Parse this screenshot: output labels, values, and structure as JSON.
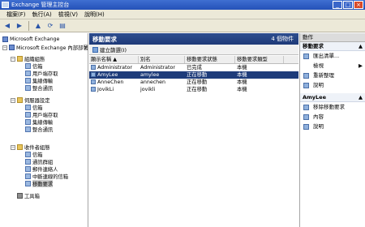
{
  "window": {
    "title": "Exchange 管理主控台",
    "minimize": "_",
    "maximize": "□",
    "close": "×"
  },
  "menu": [
    "檔案(F)",
    "執行(A)",
    "檢視(V)",
    "說明(H)"
  ],
  "toolbar": {
    "back": "◀",
    "forward": "▶",
    "up": "▲",
    "refresh": "⟳",
    "properties": "▤"
  },
  "tree": {
    "root": "Microsoft Exchange",
    "org": "Microsoft Exchange 內部部署",
    "org_config": "組織組態",
    "org_children": [
      "信箱",
      "用戶端存取",
      "集線傳輸",
      "整合通訊"
    ],
    "server_config": "伺服器設定",
    "server_children": [
      "信箱",
      "用戶端存取",
      "集線傳輸",
      "整合通訊"
    ],
    "recipient_config": "收件者組態",
    "recipient_children": [
      "信箱",
      "通訊群組",
      "郵件連絡人",
      "中斷連線的信箱",
      "移動要求"
    ],
    "tools": "工具箱"
  },
  "center": {
    "title": "移動要求",
    "count": "4 個物件",
    "new_filter": "建立篩選(I)",
    "columns": [
      "顯示名稱 ▲",
      "別名",
      "移動要求狀態",
      "移動要求類型"
    ],
    "rows": [
      [
        "Administrator",
        "Administrator",
        "已完成",
        "本機"
      ],
      [
        "AmyLee",
        "amylee",
        "正在移動",
        "本機"
      ],
      [
        "AnneChen",
        "annechen",
        "正在移動",
        "本機"
      ],
      [
        "JovikLi",
        "jovikli",
        "正在移動",
        "本機"
      ]
    ]
  },
  "actions": {
    "title": "動作",
    "group1": "移動要求",
    "group1_items": [
      "匯出清單...",
      "檢視",
      "重新整理",
      "說明"
    ],
    "group2": "AmyLee",
    "group2_items": [
      "移除移動要求",
      "內容",
      "說明"
    ],
    "expand": "▲",
    "submenu": "▶"
  }
}
